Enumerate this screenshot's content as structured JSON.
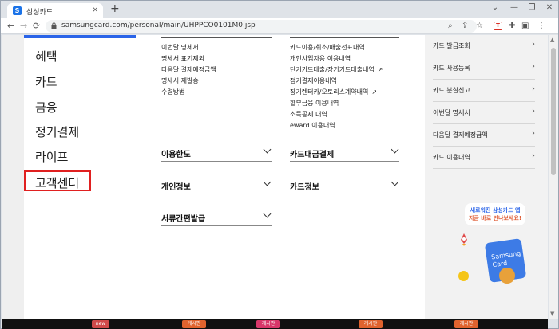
{
  "browser": {
    "tab_title": "삼성카드",
    "tab_favicon": "S",
    "url": "samsungcard.com/personal/main/UHPPCO0101M0.jsp",
    "tab_close": "×",
    "new_tab": "+",
    "nav_back": "←",
    "nav_forward": "→",
    "reload": "C"
  },
  "left_nav": {
    "items": [
      "혜택",
      "카드",
      "금융",
      "정기결제",
      "라이프",
      "고객센터"
    ],
    "highlighted": "고객센터",
    "accent_color": "#2a64e8",
    "highlight_color": "#e02020"
  },
  "content": {
    "col1_links": [
      "이번달 명세서",
      "명세서 표기제외",
      "다음달 결제예정금액",
      "명세서 재발송",
      "수령방법"
    ],
    "col2_links": [
      {
        "label": "카드이용/취소/매출전표내역",
        "external": false
      },
      {
        "label": "개인사업자용 이용내역",
        "external": false
      },
      {
        "label": "단기카드대출/장기카드대출내역",
        "external": true
      },
      {
        "label": "정기결제이용내역",
        "external": false
      },
      {
        "label": "장기렌터카/오토리스계약내역",
        "external": true
      },
      {
        "label": "할부금융 이용내역",
        "external": false
      },
      {
        "label": "소득공제 내역",
        "external": false
      },
      {
        "label": "eward 이용내역",
        "external": false
      }
    ],
    "sections_col1": [
      "이용한도",
      "개인정보",
      "서류간편발급"
    ],
    "sections_col2": [
      "카드대금결제",
      "카드정보"
    ]
  },
  "right_col": {
    "items": [
      "카드 발급조회",
      "카드 사용등록",
      "카드 분실신고",
      "이번달 명세서",
      "다음달 결제예정금액",
      "카드 이용내역"
    ],
    "promo_line1": "새로워진 삼성카드 앱",
    "promo_line2": "지금 바로 만나보세요!",
    "card_text": "Samsung Card"
  },
  "bottom_chips": [
    "new",
    "게시판",
    "게시판",
    "게시판",
    "게시판"
  ]
}
